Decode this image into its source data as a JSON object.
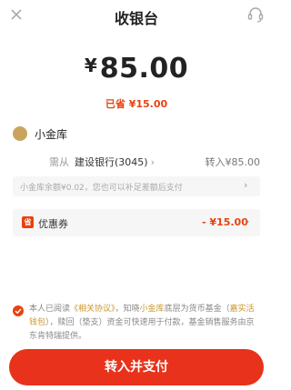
{
  "header": {
    "title": "收银台",
    "close_icon": "close-icon",
    "service_icon": "headset-icon"
  },
  "amount": {
    "currency": "¥",
    "value": "85.00"
  },
  "saved_text": "已省 ¥15.00",
  "vault": {
    "icon": "coin-bag-icon",
    "label": "小金库"
  },
  "payment": {
    "from_label": "需从",
    "bank": "建设银行(3045)",
    "transfer": "转入¥85.00"
  },
  "balance_notice": "小金库余额¥0.02，您也可以补足差额后支付",
  "coupon": {
    "icon_text": "省",
    "label": "优惠券",
    "value": "- ¥15.00"
  },
  "agreement": {
    "part1": "本人已阅读",
    "link1": "《相关协议》",
    "part2": "，知晓",
    "link2": "小金库",
    "part3": "底层为货币基金（",
    "link3": "嘉实活钱包",
    "part4": "），赎回（垫支）资金可快速用于付款，基金销售服务由京东肯特瑞提供。"
  },
  "pay_button": "转入并支付",
  "colors": {
    "accent": "#e8321b",
    "saved": "#e8420f",
    "link": "#c9952e"
  }
}
